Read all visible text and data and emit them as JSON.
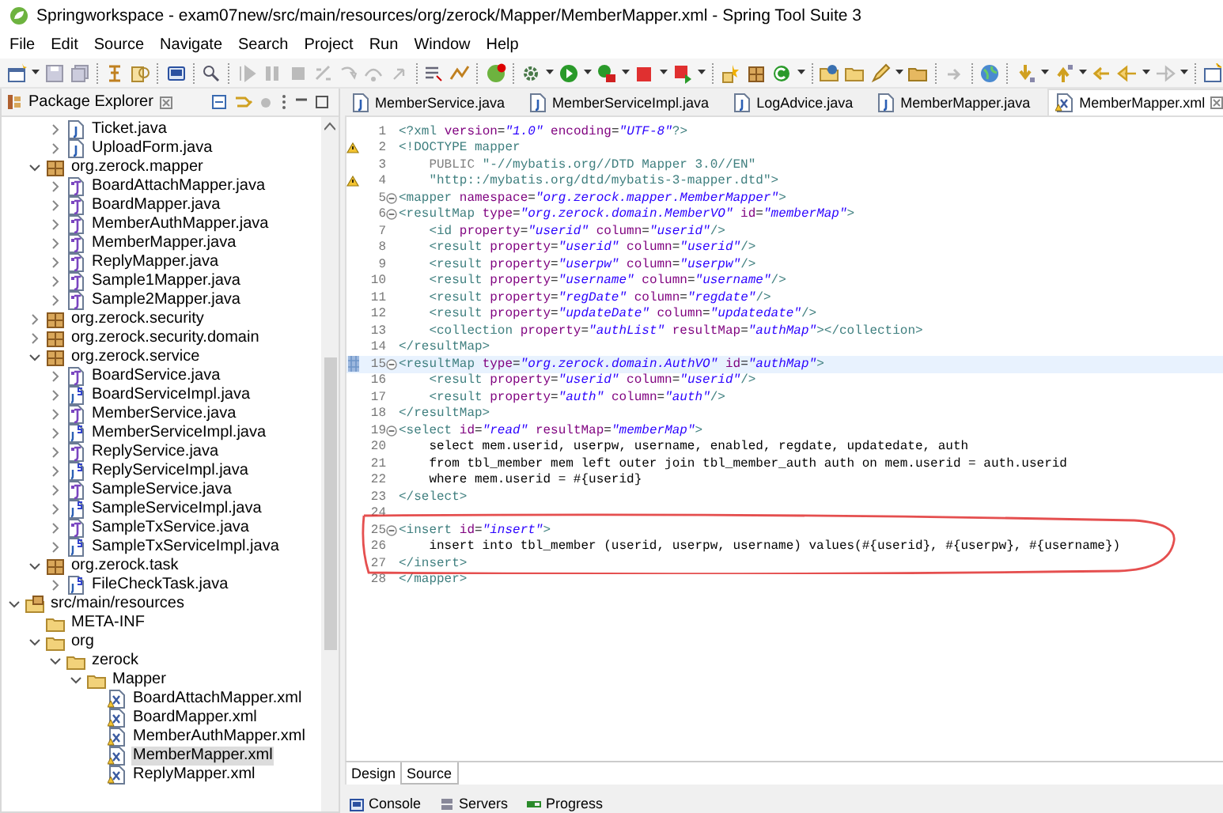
{
  "window": {
    "title": "Springworkspace - exam07new/src/main/resources/org/zerock/Mapper/MemberMapper.xml - Spring Tool Suite 3"
  },
  "menu": [
    "File",
    "Edit",
    "Source",
    "Navigate",
    "Search",
    "Project",
    "Run",
    "Window",
    "Help"
  ],
  "explorer": {
    "title": "Package Explorer",
    "tree": [
      {
        "kind": "offscreen",
        "children": [
          {
            "kind": "offscreen",
            "children": [
              {
                "kind": "offscreen",
                "children": [
                  {
                    "label": "Ticket.java",
                    "kind": "class",
                    "expanded": false,
                    "selected": false
                  },
                  {
                    "label": "UploadForm.java",
                    "kind": "class",
                    "expanded": false,
                    "selected": false
                  }
                ]
              },
              {
                "label": "org.zerock.mapper",
                "kind": "package",
                "expanded": true,
                "selected": false,
                "children": [
                  {
                    "label": "BoardAttachMapper.java",
                    "kind": "interface",
                    "expanded": false,
                    "selected": false
                  },
                  {
                    "label": "BoardMapper.java",
                    "kind": "interface",
                    "expanded": false,
                    "selected": false
                  },
                  {
                    "label": "MemberAuthMapper.java",
                    "kind": "interface",
                    "expanded": false,
                    "selected": false
                  },
                  {
                    "label": "MemberMapper.java",
                    "kind": "interface",
                    "expanded": false,
                    "selected": false
                  },
                  {
                    "label": "ReplyMapper.java",
                    "kind": "interface",
                    "expanded": false,
                    "selected": false
                  },
                  {
                    "label": "Sample1Mapper.java",
                    "kind": "interface",
                    "expanded": false,
                    "selected": false
                  },
                  {
                    "label": "Sample2Mapper.java",
                    "kind": "interface",
                    "expanded": false,
                    "selected": false
                  }
                ]
              },
              {
                "label": "org.zerock.security",
                "kind": "package",
                "expanded": false,
                "selected": false
              },
              {
                "label": "org.zerock.security.domain",
                "kind": "package",
                "expanded": false,
                "selected": false
              },
              {
                "label": "org.zerock.service",
                "kind": "package",
                "expanded": true,
                "selected": false,
                "children": [
                  {
                    "label": "BoardService.java",
                    "kind": "interface",
                    "expanded": false,
                    "selected": false
                  },
                  {
                    "label": "BoardServiceImpl.java",
                    "kind": "impl",
                    "expanded": false,
                    "selected": false
                  },
                  {
                    "label": "MemberService.java",
                    "kind": "interface",
                    "expanded": false,
                    "selected": false
                  },
                  {
                    "label": "MemberServiceImpl.java",
                    "kind": "impl",
                    "expanded": false,
                    "selected": false
                  },
                  {
                    "label": "ReplyService.java",
                    "kind": "interface",
                    "expanded": false,
                    "selected": false
                  },
                  {
                    "label": "ReplyServiceImpl.java",
                    "kind": "impl",
                    "expanded": false,
                    "selected": false
                  },
                  {
                    "label": "SampleService.java",
                    "kind": "interface",
                    "expanded": false,
                    "selected": false
                  },
                  {
                    "label": "SampleServiceImpl.java",
                    "kind": "impl",
                    "expanded": false,
                    "selected": false
                  },
                  {
                    "label": "SampleTxService.java",
                    "kind": "interface",
                    "expanded": false,
                    "selected": false
                  },
                  {
                    "label": "SampleTxServiceImpl.java",
                    "kind": "impl",
                    "expanded": false,
                    "selected": false
                  }
                ]
              },
              {
                "label": "org.zerock.task",
                "kind": "package",
                "expanded": true,
                "selected": false,
                "children": [
                  {
                    "label": "FileCheckTask.java",
                    "kind": "impl",
                    "expanded": false,
                    "selected": false
                  }
                ]
              }
            ]
          },
          {
            "label": "src/main/resources",
            "kind": "source-folder",
            "expanded": true,
            "selected": false,
            "children": [
              {
                "label": "META-INF",
                "kind": "folder",
                "selected": false
              },
              {
                "label": "org",
                "kind": "folder",
                "expanded": true,
                "selected": false,
                "children": [
                  {
                    "label": "zerock",
                    "kind": "folder",
                    "expanded": true,
                    "selected": false,
                    "children": [
                      {
                        "label": "Mapper",
                        "kind": "folder",
                        "expanded": true,
                        "selected": false,
                        "children": [
                          {
                            "label": "BoardAttachMapper.xml",
                            "kind": "xml",
                            "selected": false
                          },
                          {
                            "label": "BoardMapper.xml",
                            "kind": "xml",
                            "selected": false
                          },
                          {
                            "label": "MemberAuthMapper.xml",
                            "kind": "xml",
                            "selected": false
                          },
                          {
                            "label": "MemberMapper.xml",
                            "kind": "xml",
                            "selected": true
                          },
                          {
                            "label": "ReplyMapper.xml",
                            "kind": "xml",
                            "selected": false
                          }
                        ]
                      }
                    ]
                  }
                ]
              }
            ]
          }
        ]
      }
    ]
  },
  "editor": {
    "tabs": [
      {
        "label": "MemberService.java",
        "kind": "java",
        "selected": false
      },
      {
        "label": "MemberServiceImpl.java",
        "kind": "java",
        "selected": false
      },
      {
        "label": "LogAdvice.java",
        "kind": "java",
        "selected": false
      },
      {
        "label": "MemberMapper.java",
        "kind": "java",
        "selected": false
      },
      {
        "label": "MemberMapper.xml",
        "kind": "xml",
        "selected": true
      }
    ],
    "lines": [
      {
        "n": "1",
        "warning": false,
        "fold": false,
        "current": false,
        "seg": [
          {
            "kind": "tag",
            "text": "<?xml "
          },
          {
            "kind": "attr",
            "text": "version"
          },
          {
            "kind": "plain",
            "text": "="
          },
          {
            "kind": "string",
            "text": "\"1.0\""
          },
          {
            "kind": "attr",
            "text": " encoding"
          },
          {
            "kind": "plain",
            "text": "="
          },
          {
            "kind": "string",
            "text": "\"UTF-8\""
          },
          {
            "kind": "tag",
            "text": "?>"
          }
        ]
      },
      {
        "n": "2",
        "warning": true,
        "fold": false,
        "current": false,
        "seg": [
          {
            "kind": "tag",
            "text": "<!DOCTYPE mapper"
          }
        ]
      },
      {
        "n": "3",
        "warning": false,
        "fold": false,
        "current": false,
        "seg": [
          {
            "kind": "keyword",
            "text": "    PUBLIC "
          },
          {
            "kind": "doctype",
            "text": "\"-//mybatis.org//DTD Mapper 3.0//EN\""
          }
        ]
      },
      {
        "n": "4",
        "warning": true,
        "fold": false,
        "current": false,
        "seg": [
          {
            "kind": "doctype",
            "text": "    \"http::/mybatis.org/dtd/mybatis-3-mapper.dtd\""
          },
          {
            "kind": "tag",
            "text": ">"
          }
        ]
      },
      {
        "n": "5",
        "warning": false,
        "fold": true,
        "current": false,
        "seg": [
          {
            "kind": "tag",
            "text": "<mapper "
          },
          {
            "kind": "attr",
            "text": "namespace"
          },
          {
            "kind": "plain",
            "text": "="
          },
          {
            "kind": "string",
            "text": "\"org.zerock.mapper.MemberMapper\""
          },
          {
            "kind": "tag",
            "text": ">"
          }
        ]
      },
      {
        "n": "6",
        "warning": false,
        "fold": true,
        "current": false,
        "seg": [
          {
            "kind": "tag",
            "text": "<resultMap "
          },
          {
            "kind": "attr",
            "text": "type"
          },
          {
            "kind": "plain",
            "text": "="
          },
          {
            "kind": "string",
            "text": "\"org.zerock.domain.MemberVO\""
          },
          {
            "kind": "attr",
            "text": " id"
          },
          {
            "kind": "plain",
            "text": "="
          },
          {
            "kind": "string",
            "text": "\"memberMap\""
          },
          {
            "kind": "tag",
            "text": ">"
          }
        ]
      },
      {
        "n": "7",
        "warning": false,
        "fold": false,
        "current": false,
        "seg": [
          {
            "kind": "tag",
            "text": "    <id "
          },
          {
            "kind": "attr",
            "text": "property"
          },
          {
            "kind": "plain",
            "text": "="
          },
          {
            "kind": "string",
            "text": "\"userid\""
          },
          {
            "kind": "attr",
            "text": " column"
          },
          {
            "kind": "plain",
            "text": "="
          },
          {
            "kind": "string",
            "text": "\"userid\""
          },
          {
            "kind": "tag",
            "text": "/>"
          }
        ]
      },
      {
        "n": "8",
        "warning": false,
        "fold": false,
        "current": false,
        "seg": [
          {
            "kind": "tag",
            "text": "    <result "
          },
          {
            "kind": "attr",
            "text": "property"
          },
          {
            "kind": "plain",
            "text": "="
          },
          {
            "kind": "string",
            "text": "\"userid\""
          },
          {
            "kind": "attr",
            "text": " column"
          },
          {
            "kind": "plain",
            "text": "="
          },
          {
            "kind": "string",
            "text": "\"userid\""
          },
          {
            "kind": "tag",
            "text": "/>"
          }
        ]
      },
      {
        "n": "9",
        "warning": false,
        "fold": false,
        "current": false,
        "seg": [
          {
            "kind": "tag",
            "text": "    <result "
          },
          {
            "kind": "attr",
            "text": "property"
          },
          {
            "kind": "plain",
            "text": "="
          },
          {
            "kind": "string",
            "text": "\"userpw\""
          },
          {
            "kind": "attr",
            "text": " column"
          },
          {
            "kind": "plain",
            "text": "="
          },
          {
            "kind": "string",
            "text": "\"userpw\""
          },
          {
            "kind": "tag",
            "text": "/>"
          }
        ]
      },
      {
        "n": "10",
        "warning": false,
        "fold": false,
        "current": false,
        "seg": [
          {
            "kind": "tag",
            "text": "    <result "
          },
          {
            "kind": "attr",
            "text": "property"
          },
          {
            "kind": "plain",
            "text": "="
          },
          {
            "kind": "string",
            "text": "\"username\""
          },
          {
            "kind": "attr",
            "text": " column"
          },
          {
            "kind": "plain",
            "text": "="
          },
          {
            "kind": "string",
            "text": "\"username\""
          },
          {
            "kind": "tag",
            "text": "/>"
          }
        ]
      },
      {
        "n": "11",
        "warning": false,
        "fold": false,
        "current": false,
        "seg": [
          {
            "kind": "tag",
            "text": "    <result "
          },
          {
            "kind": "attr",
            "text": "property"
          },
          {
            "kind": "plain",
            "text": "="
          },
          {
            "kind": "string",
            "text": "\"regDate\""
          },
          {
            "kind": "attr",
            "text": " column"
          },
          {
            "kind": "plain",
            "text": "="
          },
          {
            "kind": "string",
            "text": "\"regdate\""
          },
          {
            "kind": "tag",
            "text": "/>"
          }
        ]
      },
      {
        "n": "12",
        "warning": false,
        "fold": false,
        "current": false,
        "seg": [
          {
            "kind": "tag",
            "text": "    <result "
          },
          {
            "kind": "attr",
            "text": "property"
          },
          {
            "kind": "plain",
            "text": "="
          },
          {
            "kind": "string",
            "text": "\"updateDate\""
          },
          {
            "kind": "attr",
            "text": " column"
          },
          {
            "kind": "plain",
            "text": "="
          },
          {
            "kind": "string",
            "text": "\"updatedate\""
          },
          {
            "kind": "tag",
            "text": "/>"
          }
        ]
      },
      {
        "n": "13",
        "warning": false,
        "fold": false,
        "current": false,
        "seg": [
          {
            "kind": "tag",
            "text": "    <collection "
          },
          {
            "kind": "attr",
            "text": "property"
          },
          {
            "kind": "plain",
            "text": "="
          },
          {
            "kind": "string",
            "text": "\"authList\""
          },
          {
            "kind": "attr",
            "text": " resultMap"
          },
          {
            "kind": "plain",
            "text": "="
          },
          {
            "kind": "string",
            "text": "\"authMap\""
          },
          {
            "kind": "tag",
            "text": "></collection>"
          }
        ]
      },
      {
        "n": "14",
        "warning": false,
        "fold": false,
        "current": false,
        "seg": [
          {
            "kind": "tag",
            "text": "</resultMap>"
          }
        ]
      },
      {
        "n": "15",
        "warning": false,
        "fold": true,
        "current": true,
        "seg": [
          {
            "kind": "tag",
            "text": "<resultMap "
          },
          {
            "kind": "attr",
            "text": "type"
          },
          {
            "kind": "plain",
            "text": "="
          },
          {
            "kind": "string",
            "text": "\"org.zerock.domain.AuthVO\""
          },
          {
            "kind": "attr",
            "text": " id"
          },
          {
            "kind": "plain",
            "text": "="
          },
          {
            "kind": "string",
            "text": "\"authMap\""
          },
          {
            "kind": "tag",
            "text": ">"
          }
        ]
      },
      {
        "n": "16",
        "warning": false,
        "fold": false,
        "current": false,
        "seg": [
          {
            "kind": "tag",
            "text": "    <result "
          },
          {
            "kind": "attr",
            "text": "property"
          },
          {
            "kind": "plain",
            "text": "="
          },
          {
            "kind": "string",
            "text": "\"userid\""
          },
          {
            "kind": "attr",
            "text": " column"
          },
          {
            "kind": "plain",
            "text": "="
          },
          {
            "kind": "string",
            "text": "\"userid\""
          },
          {
            "kind": "tag",
            "text": "/>"
          }
        ]
      },
      {
        "n": "17",
        "warning": false,
        "fold": false,
        "current": false,
        "seg": [
          {
            "kind": "tag",
            "text": "    <result "
          },
          {
            "kind": "attr",
            "text": "property"
          },
          {
            "kind": "plain",
            "text": "="
          },
          {
            "kind": "string",
            "text": "\"auth\""
          },
          {
            "kind": "attr",
            "text": " column"
          },
          {
            "kind": "plain",
            "text": "="
          },
          {
            "kind": "string",
            "text": "\"auth\""
          },
          {
            "kind": "tag",
            "text": "/>"
          }
        ]
      },
      {
        "n": "18",
        "warning": false,
        "fold": false,
        "current": false,
        "seg": [
          {
            "kind": "tag",
            "text": "</resultMap>"
          }
        ]
      },
      {
        "n": "19",
        "warning": false,
        "fold": true,
        "current": false,
        "seg": [
          {
            "kind": "tag",
            "text": "<select "
          },
          {
            "kind": "attr",
            "text": "id"
          },
          {
            "kind": "plain",
            "text": "="
          },
          {
            "kind": "string",
            "text": "\"read\""
          },
          {
            "kind": "attr",
            "text": " resultMap"
          },
          {
            "kind": "plain",
            "text": "="
          },
          {
            "kind": "string",
            "text": "\"memberMap\""
          },
          {
            "kind": "tag",
            "text": ">"
          }
        ]
      },
      {
        "n": "20",
        "warning": false,
        "fold": false,
        "current": false,
        "seg": [
          {
            "kind": "plain",
            "text": "    select mem.userid, userpw, username, enabled, regdate, updatedate, auth"
          }
        ]
      },
      {
        "n": "21",
        "warning": false,
        "fold": false,
        "current": false,
        "seg": [
          {
            "kind": "plain",
            "text": "    from tbl_member mem left outer join tbl_member_auth auth on mem.userid = auth.userid"
          }
        ]
      },
      {
        "n": "22",
        "warning": false,
        "fold": false,
        "current": false,
        "seg": [
          {
            "kind": "plain",
            "text": "    where mem.userid = #{userid}"
          }
        ]
      },
      {
        "n": "23",
        "warning": false,
        "fold": false,
        "current": false,
        "seg": [
          {
            "kind": "tag",
            "text": "</select>"
          }
        ]
      },
      {
        "n": "24",
        "warning": false,
        "fold": false,
        "current": false
      },
      {
        "n": "25",
        "warning": false,
        "fold": true,
        "current": false,
        "seg": [
          {
            "kind": "tag",
            "text": "<insert "
          },
          {
            "kind": "attr",
            "text": "id"
          },
          {
            "kind": "plain",
            "text": "="
          },
          {
            "kind": "string",
            "text": "\"insert\""
          },
          {
            "kind": "tag",
            "text": ">"
          }
        ]
      },
      {
        "n": "26",
        "warning": false,
        "fold": false,
        "current": false,
        "seg": [
          {
            "kind": "plain",
            "text": "    insert into tbl_member (userid, userpw, username) values(#{userid}, #{userpw}, #{username})"
          }
        ]
      },
      {
        "n": "27",
        "warning": false,
        "fold": false,
        "current": false,
        "seg": [
          {
            "kind": "tag",
            "text": "</insert>"
          }
        ]
      },
      {
        "n": "28",
        "warning": false,
        "fold": false,
        "current": false,
        "seg": [
          {
            "kind": "tag",
            "text": "</mapper>"
          }
        ]
      }
    ],
    "modes": [
      {
        "label": "Design",
        "selected": false
      },
      {
        "label": "Source",
        "selected": true
      }
    ]
  },
  "views": [
    {
      "label": "Console",
      "kind": "console"
    },
    {
      "label": "Servers",
      "kind": "servers"
    },
    {
      "label": "Progress",
      "kind": "progress"
    }
  ]
}
